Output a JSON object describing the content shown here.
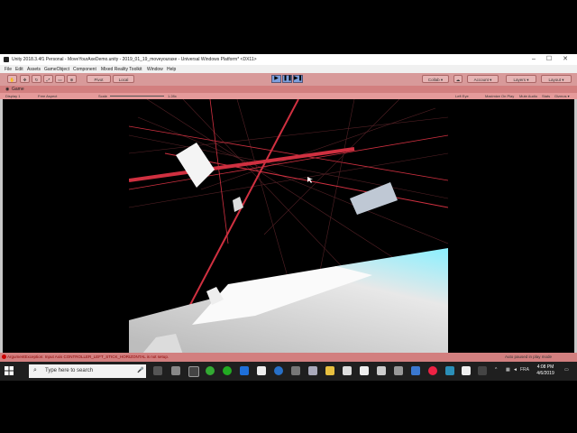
{
  "window": {
    "title": "Unity 2018.3.4f1 Personal - MoveYourAxeDemo.unity - 2019_01_19_moveyouraxe - Universal Windows Platform* <DX11>",
    "controls": [
      "–",
      "☐",
      "✕"
    ]
  },
  "menu": [
    "File",
    "Edit",
    "Assets",
    "GameObject",
    "Component",
    "Mixed Reality Toolkit",
    "Window",
    "Help"
  ],
  "toolbar": {
    "pivot_label": "Pivot",
    "local_label": "Local",
    "collab_label": "Collab ▾",
    "account_label": "Account ▾",
    "layers_label": "Layers ▾",
    "layout_label": "Layout ▾"
  },
  "game_tab": {
    "label": "Game",
    "display": "Display 1",
    "aspect": "Free Aspect",
    "scale_label": "Scale",
    "scale_value": "1.28x",
    "options": [
      "Left Eye",
      "Maximize On Play",
      "Mute Audio",
      "Stats",
      "Gizmos ▾"
    ]
  },
  "status": {
    "error": "ArgumentException: Input Axis CONTROLLER_LEFT_STICK_HORIZONTAL is not setup.",
    "info": "Auto paused in play mode"
  },
  "taskbar": {
    "search_placeholder": "Type here to search",
    "language": "FRA",
    "time": "4:08 PM",
    "date": "4/6/2019"
  },
  "colors": {
    "toolbar_tint": "#d89a9a",
    "ray_color": "#d03040",
    "floor_highlight": "#8af0ff"
  }
}
